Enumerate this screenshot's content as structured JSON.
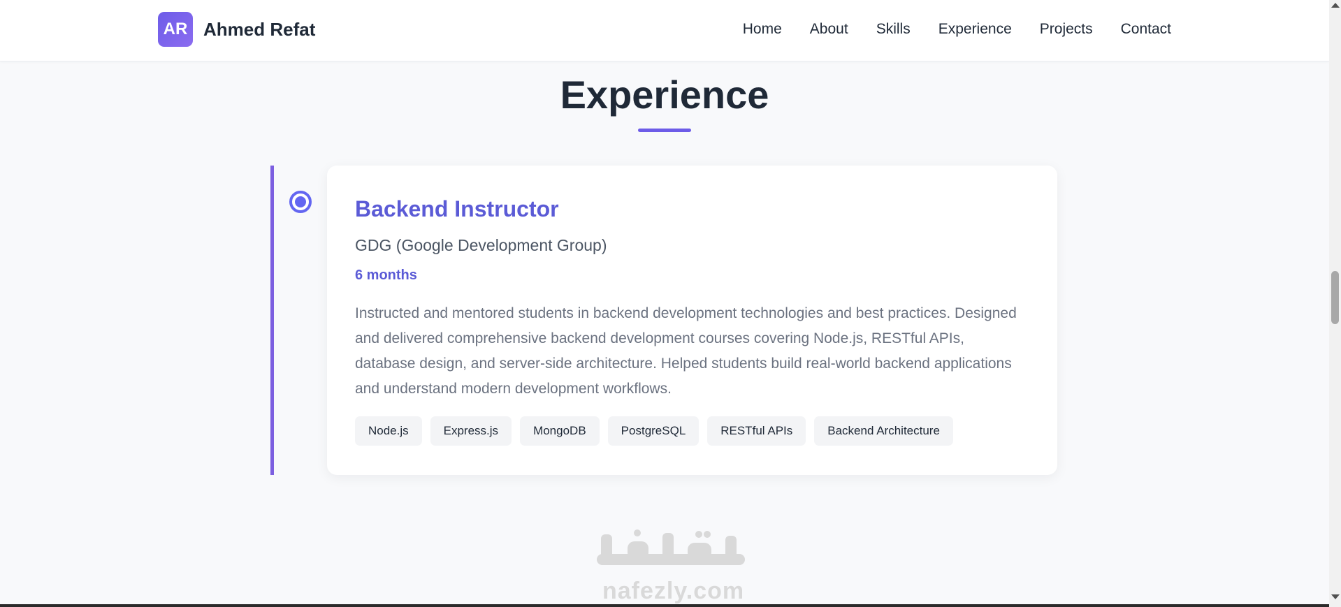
{
  "header": {
    "logo_initials": "AR",
    "brand_name": "Ahmed Refat",
    "nav": [
      {
        "label": "Home"
      },
      {
        "label": "About"
      },
      {
        "label": "Skills"
      },
      {
        "label": "Experience"
      },
      {
        "label": "Projects"
      },
      {
        "label": "Contact"
      }
    ]
  },
  "section": {
    "title": "Experience"
  },
  "experience": [
    {
      "title": "Backend Instructor",
      "company": "GDG (Google Development Group)",
      "duration": "6 months",
      "description": "Instructed and mentored students in backend development technologies and best practices. Designed and delivered comprehensive backend development courses covering Node.js, RESTful APIs, database design, and server-side architecture. Helped students build real-world backend applications and understand modern development workflows.",
      "tags": [
        "Node.js",
        "Express.js",
        "MongoDB",
        "PostgreSQL",
        "RESTful APIs",
        "Backend Architecture"
      ]
    }
  ],
  "watermark": {
    "arabic": "نفذلي",
    "text": "nafezly.com"
  },
  "colors": {
    "accent": "#6366f1",
    "brand_gradient_start": "#6d5ce8",
    "timeline": "#7c5fe0",
    "background": "#f8f9fb"
  }
}
